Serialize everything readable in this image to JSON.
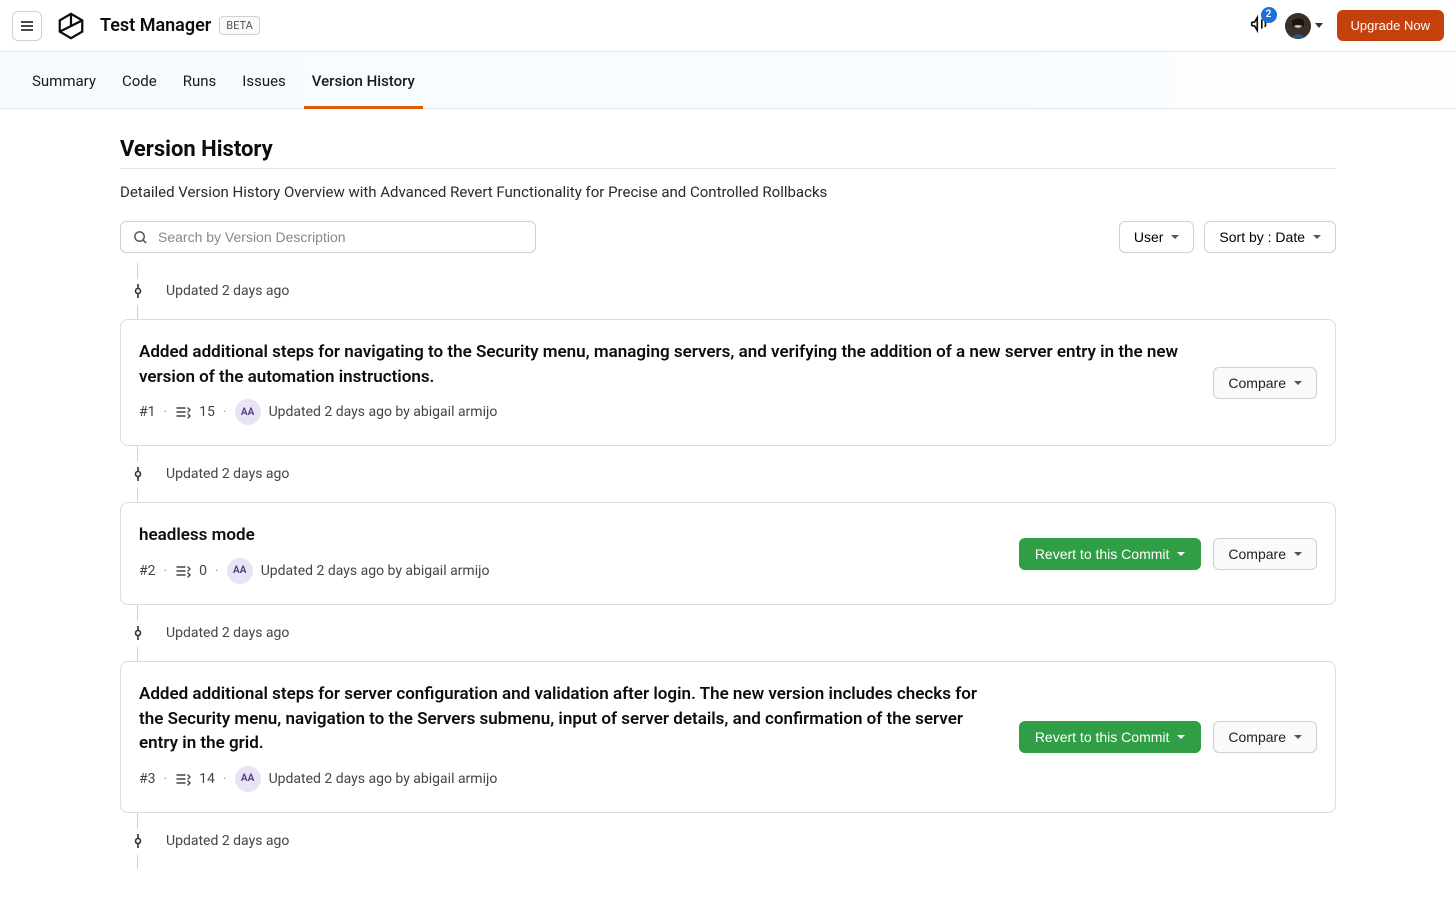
{
  "header": {
    "app_title": "Test Manager",
    "beta_label": "BETA",
    "notification_count": "2",
    "upgrade_label": "Upgrade Now"
  },
  "tabs": [
    {
      "label": "Summary",
      "active": false
    },
    {
      "label": "Code",
      "active": false
    },
    {
      "label": "Runs",
      "active": false
    },
    {
      "label": "Issues",
      "active": false
    },
    {
      "label": "Version History",
      "active": true
    }
  ],
  "page": {
    "title": "Version History",
    "subtitle": "Detailed Version History Overview with Advanced Revert Functionality for Precise and Controlled Rollbacks"
  },
  "search": {
    "placeholder": "Search by Version Description"
  },
  "filters": {
    "user_label": "User",
    "sort_label": "Sort by : Date"
  },
  "actions": {
    "compare_label": "Compare",
    "revert_label": "Revert to this Commit"
  },
  "timeline": [
    {
      "marker": "Updated 2 days ago",
      "title": "Added additional steps for navigating to the Security menu, managing servers, and verifying the addition of a new server entry in the new version of the automation instructions.",
      "id": "#1",
      "steps": "15",
      "user_initials": "AA",
      "updated_by": "Updated 2 days ago by abigail armijo",
      "show_revert": false
    },
    {
      "marker": "Updated 2 days ago",
      "title": "headless mode",
      "id": "#2",
      "steps": "0",
      "user_initials": "AA",
      "updated_by": "Updated 2 days ago by abigail armijo",
      "show_revert": true
    },
    {
      "marker": "Updated 2 days ago",
      "title": "Added additional steps for server configuration and validation after login. The new version includes checks for the Security menu, navigation to the Servers submenu, input of server details, and confirmation of the server entry in the grid.",
      "id": "#3",
      "steps": "14",
      "user_initials": "AA",
      "updated_by": "Updated 2 days ago by abigail armijo",
      "show_revert": true
    },
    {
      "marker": "Updated 2 days ago"
    }
  ]
}
